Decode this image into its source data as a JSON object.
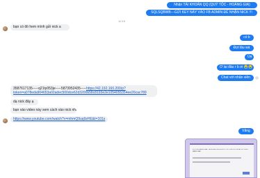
{
  "thread": {
    "timestamp": "12:19",
    "outgoing": [
      "Nhận TÀI KHOẢN QQ (QUÝ TỘC - HOÀNG GIA)",
      "SQLSQBWB---GỬI KEY NÀY VÀO FB ADMIN ĐỂ NHẬN NICK !!!",
      "có b",
      "Đợi lâu wá",
      "Ủa",
      "Ơ lại đâu r b ơi 😭😭",
      "Chat với nhân viên",
      "Vâng"
    ],
    "incoming": {
      "msg1": "bạn có đó hem mình gửi nick a",
      "account_line": "3587617135-----q21ty053je-----5873952435-----",
      "account_link": "https://42.192.160.200/p?token=a078eda904653a02adec500dce62d3200b58c8193e2e1054055354ee26cac789",
      "msg3": "dạ nick đây ạ",
      "msg4": "bạn vào video này xem cách vào nick nha",
      "video_link": "https://www.youtube.com/watch?v=mhmQ9uq9zHE&t=101s"
    },
    "screenshot_caption": "VUI LÒNG ĐĂNG NHẬP TÀI KHOẢN, KHÔNG ĐƯỢC SỬ DỤNG VPN HOẶC SỬ DỤNG MẠNG KHÁC"
  },
  "colors": {
    "outgoing_bubble": "#1e7bf2",
    "incoming_bubble": "#eef0f2",
    "link": "#1a5cc6"
  }
}
